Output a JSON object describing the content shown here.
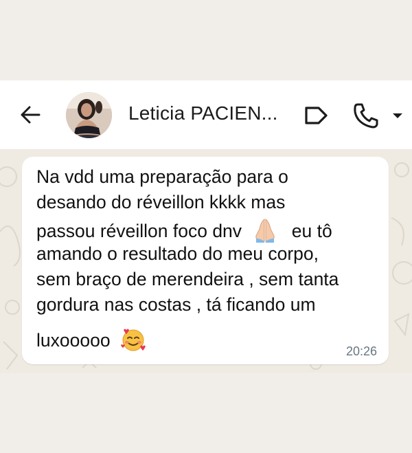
{
  "header": {
    "contact_name": "Leticia PACIEN..."
  },
  "message": {
    "line1": "Na vdd uma preparação para o",
    "line2": "desando do réveillon kkkk mas",
    "line3_a": "passou réveillon foco dnv",
    "line3_b": "eu tô",
    "line4": "amando o resultado do meu corpo,",
    "line5": "sem braço de merendeira , sem tanta",
    "line6": "gordura nas costas , tá ficando um",
    "line7": "luxooooo",
    "time": "20:26"
  },
  "icons": {
    "back": "arrow-left-icon",
    "label": "label-tag-icon",
    "call": "phone-icon",
    "dropdown": "caret-down-icon",
    "emoji1": "folded-hands-emoji",
    "emoji2": "smiling-face-with-hearts-emoji"
  },
  "colors": {
    "header_bg": "#ffffff",
    "chat_bg": "#efeae2",
    "bubble_bg": "#ffffff",
    "text": "#111111",
    "time": "#667781"
  }
}
